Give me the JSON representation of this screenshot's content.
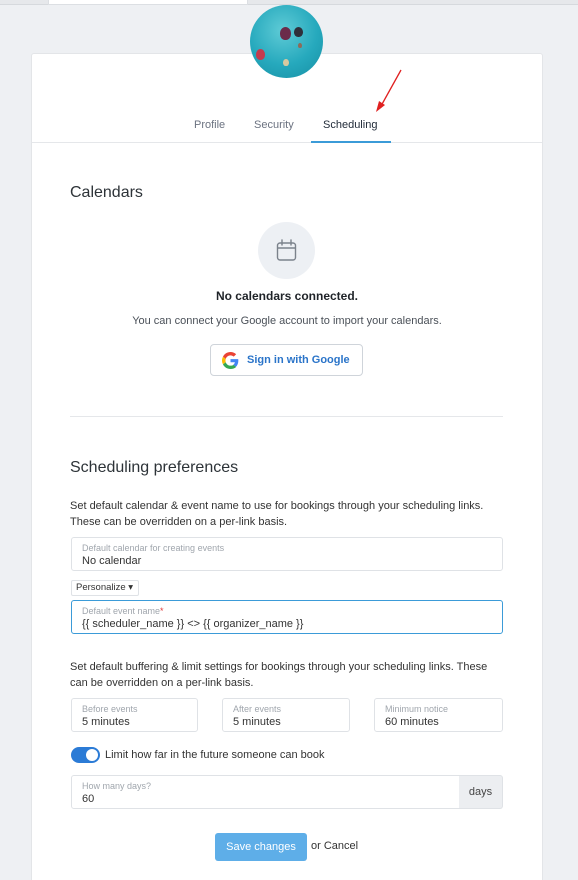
{
  "tabs": [
    {
      "label": "Profile"
    },
    {
      "label": "Security"
    },
    {
      "label": "Scheduling"
    }
  ],
  "calendars": {
    "heading": "Calendars",
    "empty_title": "No calendars connected.",
    "empty_desc": "You can connect your Google account to import your calendars.",
    "google_button": "Sign in with Google"
  },
  "prefs": {
    "heading": "Scheduling preferences",
    "desc1_line1": "Set default calendar & event name to use for bookings through your scheduling links.",
    "desc1_line2": "These can be overridden on a per-link basis.",
    "calendar_field": {
      "label": "Default calendar for creating events",
      "value": "No calendar"
    },
    "personalize_label": "Personalize ▾",
    "event_name_field": {
      "label": "Default event name",
      "required_mark": "*",
      "value": "{{ scheduler_name }} <> {{ organizer_name }}"
    },
    "desc2_line1": "Set default buffering & limit settings for bookings through your scheduling links. These",
    "desc2_line2": "can be overridden on a per-link basis.",
    "before_events": {
      "label": "Before events",
      "value": "5 minutes"
    },
    "after_events": {
      "label": "After events",
      "value": "5 minutes"
    },
    "minimum_notice": {
      "label": "Minimum notice",
      "value": "60 minutes"
    },
    "limit_toggle": {
      "label": "Limit how far in the future someone can book",
      "on": true
    },
    "days_field": {
      "label": "How many days?",
      "value": "60",
      "unit": "days"
    }
  },
  "actions": {
    "save": "Save changes",
    "or": "or",
    "cancel": "Cancel"
  },
  "colors": {
    "accent": "#3b9bd8",
    "save_button": "#5eaee8",
    "toggle_on": "#2b7bd6",
    "google_text": "#2a74c9",
    "annotation_arrow": "#e02020"
  },
  "icons": [
    "calendar-icon",
    "google-g-icon",
    "caret-down-icon"
  ]
}
